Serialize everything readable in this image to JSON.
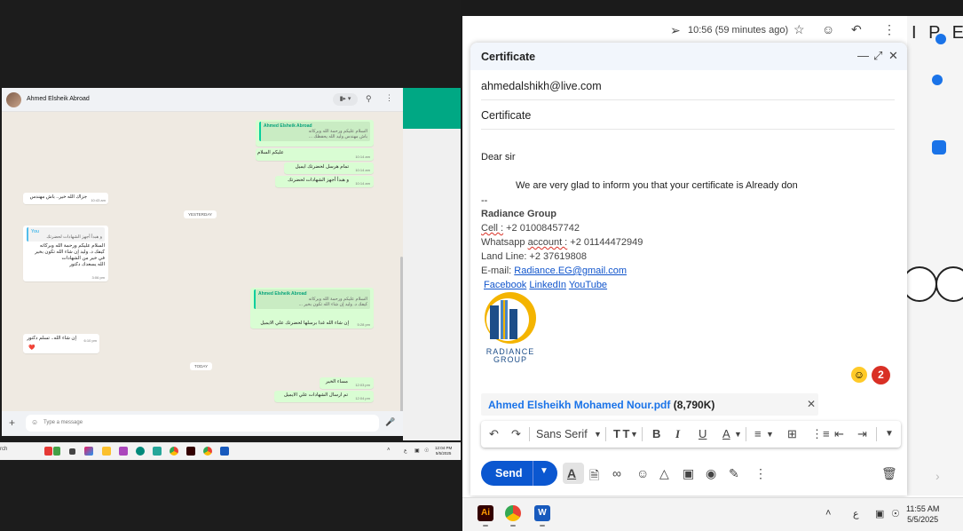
{
  "whatsapp": {
    "contact_name": "Ahmed Elsheik Abroad",
    "input_placeholder": "Type a message",
    "date_yesterday": "YESTERDAY",
    "date_today": "TODAY",
    "messages": [
      {
        "quote_name": "Ahmed Elsheik Abroad",
        "quote_text": "السلام عليكم ورحمة الله وبركاته\nباش مهندس وليد الله يحفظك ...",
        "text": "",
        "time": ""
      },
      {
        "text": "عليكم السلام",
        "time": "10:14 am"
      },
      {
        "text": "تمام هرسل لحضرتك ايميل",
        "time": "10:14 am"
      },
      {
        "text": "و هبدأ أجهز الشهادات لحضرتك",
        "time": "10:14 am"
      },
      {
        "text": "جزاك الله خير.. باش مهندس",
        "time": "10:43 am"
      },
      {
        "quote_name": "You",
        "quote_text": "و هبدأ أجهز الشهادات لحضرتك",
        "text": "السلام عليكم ورحمة الله وبركاته\nكيفك د. وليد إن شاء الله تكون بخير\nفي خير من الشهادات\nالله يسعدك دكتور",
        "time": "3:06 pm"
      },
      {
        "quote_name": "Ahmed Elsheik Abroad",
        "quote_text": "السلام عليكم ورحمة الله وبركاته\nكيفك د. وليد إن شاء الله تكون بخير ...",
        "text": "إن شاء الله غدا برسلها لحضرتك علي الايميل",
        "time": "5:28 pm"
      },
      {
        "text": "إن شاء الله.. تسلم دكتور",
        "time": "6:10 pm",
        "emoji": "❤️"
      },
      {
        "text": "مساء الخير",
        "time": "12:03 pm"
      },
      {
        "text": "تم ارسال الشهادات علي الايميل",
        "time": "12:04 pm"
      }
    ]
  },
  "left_taskbar": {
    "search_label": "rch",
    "time": "12:04 PM",
    "date": "5/5/2025",
    "lang": "ع"
  },
  "gmail": {
    "meta_time": "10:56 (59 minutes ago)",
    "compose_title": "Certificate",
    "to": "ahmedalshikh@live.com",
    "subject": "Certificate",
    "body": {
      "greeting": "Dear sir",
      "line1": "We are very glad to inform you that your certificate is Already don",
      "sig_sep": "--",
      "company": "Radiance Group",
      "cell_label": "Cell :",
      "cell_value": " +2 01008457742",
      "whatsapp_label": "Whatsapp ",
      "whatsapp_account": "account :",
      "whatsapp_value": " +2 01144472949",
      "landline": "Land Line: +2 37619808",
      "email_label": "E-mail: ",
      "email_value": "Radiance.EG@gmail.com",
      "social_facebook": "Facebook",
      "social_linkedin": "LinkedIn",
      "social_youtube": "YouTube",
      "logo_text_line1": "RADIANCE",
      "logo_text_line2": "GROUP"
    },
    "badge_count": "2",
    "attachment_name": "Ahmed Elsheikh Mohamed Nour.pdf",
    "attachment_size": "(8,790K)",
    "font_name": "Sans Serif",
    "send_label": "Send"
  },
  "right_edge": {
    "letters": "I P E"
  },
  "right_taskbar": {
    "time": "11:55 AM",
    "date": "5/5/2025",
    "lang": "ع"
  },
  "colors": {
    "whatsapp_accent": "#00a884",
    "gmail_send": "#0b57d0",
    "badge": "#d93025"
  }
}
